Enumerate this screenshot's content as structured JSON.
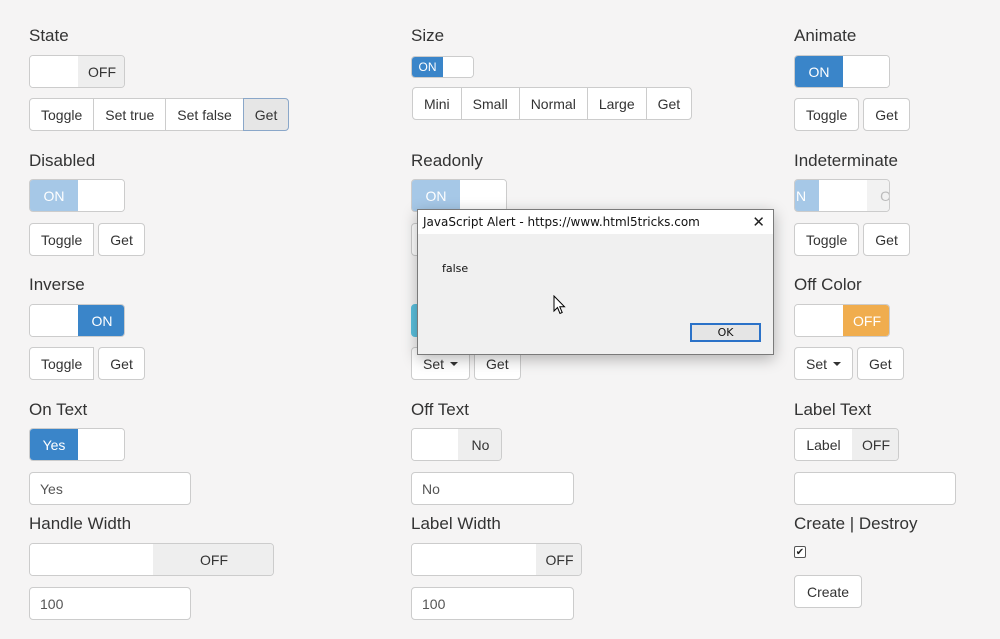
{
  "colors": {
    "on": "#3a85c9",
    "off": "#eeeeee",
    "warning": "#f0ad4e"
  },
  "col1": {
    "state": {
      "label": "State",
      "off": "OFF",
      "buttons": [
        "Toggle",
        "Set true",
        "Set false",
        "Get"
      ]
    },
    "disabled": {
      "label": "Disabled",
      "on": "ON",
      "buttons": [
        "Toggle",
        "Get"
      ]
    },
    "inverse": {
      "label": "Inverse",
      "on": "ON",
      "buttons": [
        "Toggle",
        "Get"
      ]
    },
    "on_text": {
      "label": "On Text",
      "on": "Yes",
      "input": "Yes"
    },
    "handle_width": {
      "label": "Handle Width",
      "off": "OFF",
      "input": "100"
    }
  },
  "col2": {
    "size": {
      "label": "Size",
      "on": "ON",
      "buttons": [
        "Mini",
        "Small",
        "Normal",
        "Large",
        "Get"
      ]
    },
    "readonly": {
      "label": "Readonly",
      "on": "ON"
    },
    "color": {
      "buttons": [
        "Set",
        "Get"
      ]
    },
    "off_text": {
      "label": "Off Text",
      "off": "No",
      "input": "No"
    },
    "label_width": {
      "label": "Label Width",
      "off": "OFF",
      "input": "100"
    }
  },
  "col3": {
    "animate": {
      "label": "Animate",
      "on": "ON",
      "buttons": [
        "Toggle",
        "Get"
      ]
    },
    "indeterminate": {
      "label": "Indeterminate",
      "on": "N",
      "off": "O",
      "buttons": [
        "Toggle",
        "Get"
      ]
    },
    "off_color": {
      "label": "Off Color",
      "off": "OFF",
      "buttons": [
        "Set",
        "Get"
      ]
    },
    "label_text": {
      "label": "Label Text",
      "label_seg": "Label",
      "off": "OFF",
      "input": ""
    },
    "create_destroy": {
      "label": "Create | Destroy",
      "check": "✔",
      "button": "Create"
    }
  },
  "alert": {
    "title": "JavaScript Alert - https://www.html5tricks.com",
    "message": "false",
    "ok": "OK",
    "close": "✕"
  }
}
